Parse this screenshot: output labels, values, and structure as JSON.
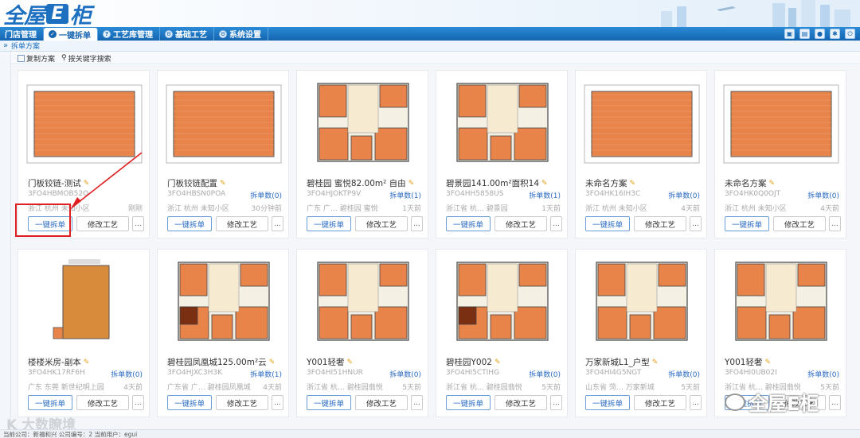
{
  "app": {
    "logo_left": "全屋",
    "logo_e": "E",
    "logo_right": "柜"
  },
  "nav": {
    "items": [
      {
        "label": "门店管理",
        "icon": ""
      },
      {
        "label": "一键拆单",
        "icon": "✓"
      },
      {
        "label": "工艺库管理",
        "icon": "?"
      },
      {
        "label": "基础工艺",
        "icon": "⚙"
      },
      {
        "label": "系统设置",
        "icon": "⚙"
      }
    ],
    "active_index": 1
  },
  "tab": {
    "title": "拆单方案"
  },
  "toolbar": {
    "copy_label": "复制方案",
    "search_label": "按关键字搜索"
  },
  "buttons": {
    "split": "一键拆单",
    "modify": "修改工艺",
    "more": "..."
  },
  "cards": [
    {
      "title": "门板铰链-测试",
      "code": "3FO4HBMOB52O",
      "count": "",
      "loc": "浙江 杭州 未知小区",
      "time": "刚刚"
    },
    {
      "title": "门板铰链配置",
      "code": "3FO4HBSN0POA",
      "count": "拆单数(0)",
      "loc": "浙江 杭州 未知小区",
      "time": "30分钟前"
    },
    {
      "title": "碧桂园 蜜悦82.00m² 自由",
      "code": "3FO4HJOKTP9V",
      "count": "拆单数(1)",
      "loc": "广东 广… 碧桂园 蜜悦",
      "time": "1天前"
    },
    {
      "title": "碧景园141.00m²面积14",
      "code": "3FO4HH5858US",
      "count": "拆单数(1)",
      "loc": "浙江省 杭… 碧景园",
      "time": "1天前"
    },
    {
      "title": "未命名方案",
      "code": "3FO4HK16IH3C",
      "count": "拆单数(0)",
      "loc": "浙江 杭州 未知小区",
      "time": "4天前"
    },
    {
      "title": "未命名方案",
      "code": "3FO4HK0Q0OJT",
      "count": "拆单数(0)",
      "loc": "浙江 杭州 未知小区",
      "time": "4天前"
    },
    {
      "title": "楼楼米房-副本",
      "code": "3FO4HK17RF6H",
      "count": "拆单数(0)",
      "loc": "广东 东莞 新世纪明上园",
      "time": "4天前"
    },
    {
      "title": "碧桂园凤凰城125.00m²云",
      "code": "3FO4HJXC3H3K",
      "count": "拆单数(1)",
      "loc": "广东省 广… 碧桂园凤凰城",
      "time": "4天前"
    },
    {
      "title": "Y001轻奢",
      "code": "3FO4HI51HNUR",
      "count": "拆单数(0)",
      "loc": "浙江省 杭… 碧桂园翡悦",
      "time": "5天前"
    },
    {
      "title": "碧桂园Y002",
      "code": "3FO4HI5CTIHG",
      "count": "拆单数(0)",
      "loc": "浙江省 杭… 碧桂园翡悦",
      "time": "5天前"
    },
    {
      "title": "万家新城L1_户型",
      "code": "3FO4HI4G5NGT",
      "count": "拆单数(0)",
      "loc": "山东省 菏… 万家新城",
      "time": "5天前"
    },
    {
      "title": "Y001轻奢",
      "code": "3FO4HI0UB02I",
      "count": "拆单数(0)",
      "loc": "浙江省 杭… 碧桂园翡悦",
      "time": "5天前"
    }
  ],
  "status": {
    "text": "当前公司：新福和兴 公司编号：2 当前用户：egui"
  },
  "watermarks": {
    "left": "K 大数瞭境",
    "right": "全屋E柜"
  },
  "colors": {
    "brand": "#1d6fc0",
    "nav": "#1565b0",
    "floor_orange": "#e8834a",
    "highlight": "#e02020"
  }
}
